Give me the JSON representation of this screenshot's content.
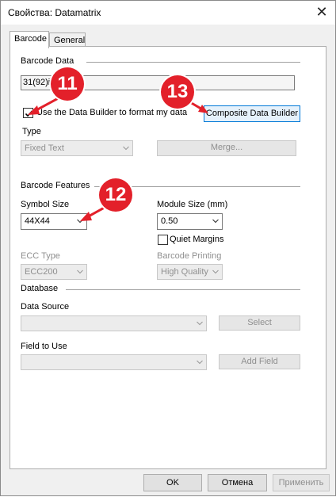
{
  "window": {
    "title": "Свойства: Datamatrix",
    "close_icon": "close-icon"
  },
  "tabs": [
    {
      "label": "Barcode",
      "active": true
    },
    {
      "label": "General",
      "active": false
    }
  ],
  "barcode_data": {
    "group_label": "Barcode Data",
    "value": "31(92)id",
    "use_builder_label": "Use the Data Builder to format my data",
    "use_builder_checked": true,
    "composite_button": "Composite Data Builder"
  },
  "type": {
    "label": "Type",
    "value": "Fixed Text",
    "merge_button": "Merge..."
  },
  "features": {
    "group_label": "Barcode Features",
    "symbol_size_label": "Symbol Size",
    "symbol_size_value": "44X44",
    "module_size_label": "Module Size (mm)",
    "module_size_value": "0.50",
    "quiet_margins_label": "Quiet Margins",
    "quiet_margins_checked": false,
    "ecc_type_label": "ECC Type",
    "ecc_type_value": "ECC200",
    "printing_label": "Barcode Printing",
    "printing_value": "High Quality"
  },
  "database": {
    "group_label": "Database",
    "data_source_label": "Data Source",
    "data_source_value": "",
    "select_button": "Select",
    "field_label": "Field to Use",
    "field_value": "",
    "add_field_button": "Add Field"
  },
  "footer": {
    "ok": "OK",
    "cancel": "Отмена",
    "apply": "Применить"
  },
  "annotations": {
    "badge_11": "11",
    "badge_12": "12",
    "badge_13": "13",
    "color": "#e3202a"
  }
}
